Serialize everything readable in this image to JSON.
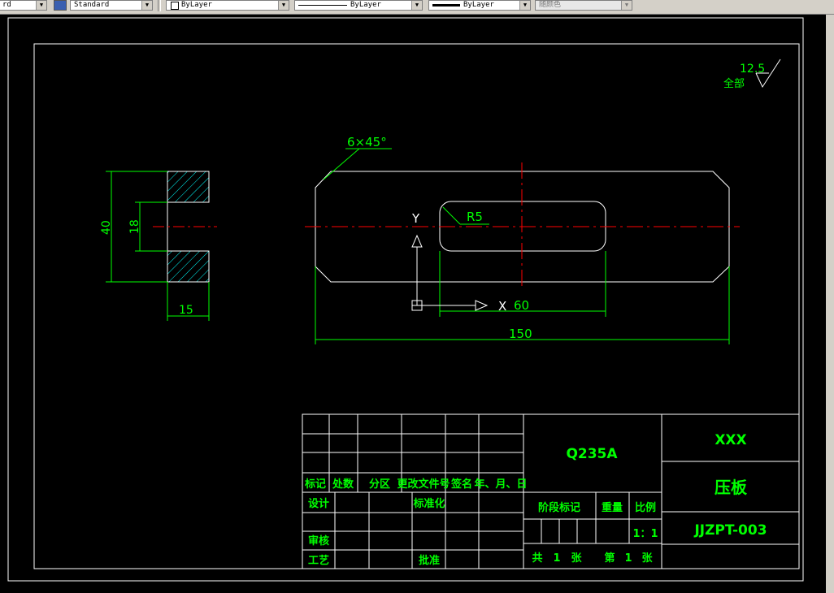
{
  "toolbar": {
    "style_combo": "rd",
    "text_style": "Standard",
    "layer": "ByLayer",
    "linetype": "ByLayer",
    "lineweight": "ByLayer",
    "plot_color": "随颜色"
  },
  "drawing": {
    "roughness_value": "12.5",
    "roughness_note": "全部",
    "chamfer_label": "6×45°",
    "radius_label": "R5",
    "dim_height": "40",
    "dim_hole": "18",
    "dim_thickness": "15",
    "dim_slot_length": "60",
    "dim_total_length": "150",
    "ucs_y": "Y",
    "ucs_x": "X"
  },
  "title_block": {
    "material": "Q235A",
    "company": "XXX",
    "part_name": "压板",
    "drawing_number": "JJZPT-003",
    "headers": [
      "标记",
      "处数",
      "分区",
      "更改文件号",
      "签名",
      "年、月、日"
    ],
    "design": "设计",
    "standardize": "标准化",
    "review": "审核",
    "process": "工艺",
    "approve": "批准",
    "stage_mark": "阶段标记",
    "weight": "重量",
    "scale_label": "比例",
    "scale_value": "1：1",
    "total": "共",
    "total_count": "1",
    "sheets": "张",
    "sheet_no_label": "第",
    "sheet_no": "1",
    "sheet_unit": "张"
  }
}
